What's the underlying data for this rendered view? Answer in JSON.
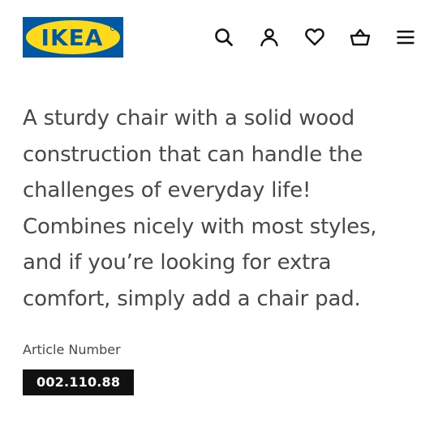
{
  "brand": {
    "logo_text": "IKEA",
    "colors": {
      "blue": "#0058A3",
      "yellow": "#FFDA1A"
    }
  },
  "header": {
    "icons": [
      {
        "name": "search-icon",
        "label": "Search"
      },
      {
        "name": "profile-icon",
        "label": "Profile"
      },
      {
        "name": "heart-icon",
        "label": "Favourites"
      },
      {
        "name": "basket-icon",
        "label": "Shopping bag"
      },
      {
        "name": "menu-icon",
        "label": "Menu"
      }
    ]
  },
  "product": {
    "description": "A sturdy chair with a solid wood construction that can handle the challenges of everyday life! Combines nicely with most styles, and if you’re looking for extra comfort, simply add a chair pad.",
    "article_label": "Article Number",
    "article_number": "002.110.88"
  },
  "colors": {
    "text": "#484848",
    "badge_bg": "#111111",
    "badge_text": "#FFFFFF"
  }
}
